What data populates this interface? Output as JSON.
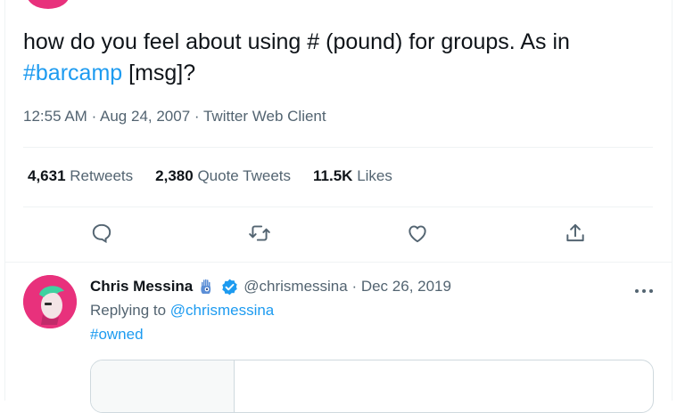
{
  "tweet": {
    "text_before": "how do you feel about using # (pound) for groups. As in ",
    "hashtag": "#barcamp",
    "text_after": " [msg]?",
    "time": "12:55 AM",
    "date": "Aug 24, 2007",
    "client": "Twitter Web Client"
  },
  "stats": {
    "retweets_count": "4,631",
    "retweets_label": "Retweets",
    "quotes_count": "2,380",
    "quotes_label": "Quote Tweets",
    "likes_count": "11.5K",
    "likes_label": "Likes"
  },
  "actions": {
    "icons": [
      "reply-icon",
      "retweet-icon",
      "like-icon",
      "share-icon"
    ]
  },
  "reply": {
    "name": "Chris Messina",
    "handle": "@chrismessina",
    "date": "Dec 26, 2019",
    "replying_label": "Replying to",
    "replying_handle": "@chrismessina",
    "body_hashtag": "#owned"
  },
  "colors": {
    "accent": "#1d9bf0",
    "avatar": "#e8317c",
    "text": "#0f1419",
    "muted": "#536471"
  }
}
